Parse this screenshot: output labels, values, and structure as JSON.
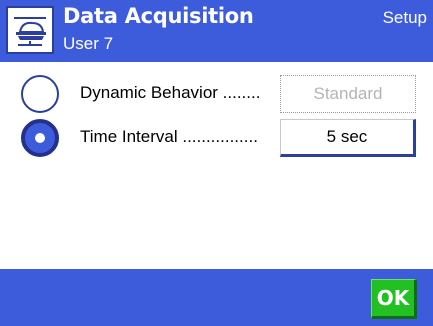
{
  "header": {
    "icon": "scale-icon",
    "title": "Data Acquisition",
    "subtitle": "User 7",
    "mode": "Setup"
  },
  "settings": [
    {
      "label": "Dynamic Behavior ........",
      "value": "Standard",
      "selected": false,
      "enabled": false
    },
    {
      "label": "Time Interval ................",
      "value": "5 sec",
      "selected": true,
      "enabled": true
    }
  ],
  "footer": {
    "ok_label": "OK"
  },
  "colors": {
    "header_bg": "#3d5cdc",
    "ok_green": "#22c022",
    "radio_border": "#2b3f9c"
  }
}
